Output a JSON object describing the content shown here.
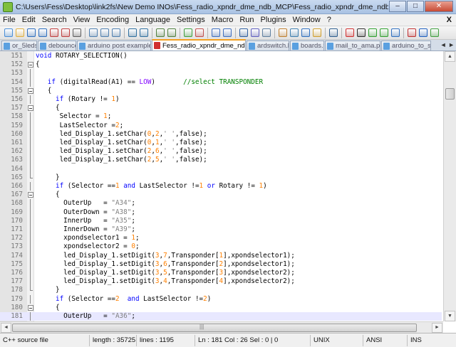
{
  "window": {
    "title": "C:\\Users\\Fess\\Desktop\\link2fs\\New Demo INOs\\Fess_radio_xpndr_dme_ndb_MCP\\Fess_radio_xpndr_dme_ndb_MCP.ino - Notepad++ [Administrator]",
    "minimize": "–",
    "maximize": "□",
    "close": "✕"
  },
  "menu": [
    "File",
    "Edit",
    "Search",
    "View",
    "Encoding",
    "Language",
    "Settings",
    "Macro",
    "Run",
    "Plugins",
    "Window",
    "?"
  ],
  "menu_close": "X",
  "toolbar": [
    "new-file-icon",
    "open-file-icon",
    "save-icon",
    "save-all-icon",
    "close-icon",
    "close-all-icon",
    "print-icon",
    "sep",
    "cut-icon",
    "copy-icon",
    "paste-icon",
    "sep",
    "undo-icon",
    "redo-icon",
    "sep",
    "find-icon",
    "replace-icon",
    "sep",
    "zoom-in-icon",
    "zoom-out-icon",
    "sep",
    "sync-vertical-icon",
    "sync-horizontal-icon",
    "sep",
    "word-wrap-icon",
    "show-all-chars-icon",
    "indent-guide-icon",
    "sep",
    "user-language-icon",
    "doc-map-icon",
    "function-list-icon",
    "folder-workspace-icon",
    "sep",
    "monitoring-icon",
    "sep",
    "record-macro-icon",
    "stop-record-icon",
    "play-macro-icon",
    "play-multiple-icon",
    "save-macro-icon",
    "sep",
    "spell-check-icon",
    "spell-next-icon",
    "spell-settings-icon"
  ],
  "tabs": [
    {
      "label": "or_5leds.ino",
      "active": false
    },
    {
      "label": "debounce.c",
      "active": false
    },
    {
      "label": "arduino post example.txt",
      "active": false
    },
    {
      "label": "Fess_radio_xpndr_dme_ndb_MCP.ino",
      "active": true
    },
    {
      "label": "ardswitch.lua",
      "active": false
    },
    {
      "label": "boards.txt",
      "active": false
    },
    {
      "label": "mail_to_ama.php",
      "active": false
    },
    {
      "label": "arduino_to_s...",
      "active": false
    }
  ],
  "tab_scroll": "◄ ►",
  "code_lines": [
    {
      "n": "151",
      "fold": "",
      "segs": [
        {
          "c": "kw",
          "t": "void"
        },
        {
          "t": " ROTARY_SELECTION()"
        }
      ]
    },
    {
      "n": "152",
      "fold": "box",
      "segs": [
        {
          "t": "{"
        }
      ]
    },
    {
      "n": "153",
      "fold": "bar",
      "segs": []
    },
    {
      "n": "154",
      "fold": "bar",
      "segs": [
        {
          "t": "   "
        },
        {
          "c": "kw",
          "t": "if"
        },
        {
          "t": " (digitalRead(A1) == "
        },
        {
          "c": "typ",
          "t": "LOW"
        },
        {
          "t": ")       "
        },
        {
          "c": "cmt",
          "t": "//select TRANSPONDER"
        }
      ]
    },
    {
      "n": "155",
      "fold": "box",
      "segs": [
        {
          "t": "   {"
        }
      ]
    },
    {
      "n": "156",
      "fold": "bar",
      "segs": [
        {
          "t": "     "
        },
        {
          "c": "kw",
          "t": "if"
        },
        {
          "t": " (Rotary != "
        },
        {
          "c": "num",
          "t": "1"
        },
        {
          "t": ")"
        }
      ]
    },
    {
      "n": "157",
      "fold": "box",
      "segs": [
        {
          "t": "     {"
        }
      ]
    },
    {
      "n": "158",
      "fold": "bar",
      "segs": [
        {
          "t": "      Selector = "
        },
        {
          "c": "num",
          "t": "1"
        },
        {
          "t": ";"
        }
      ]
    },
    {
      "n": "159",
      "fold": "bar",
      "segs": [
        {
          "t": "      LastSelector ="
        },
        {
          "c": "num",
          "t": "2"
        },
        {
          "t": ";"
        }
      ]
    },
    {
      "n": "160",
      "fold": "bar",
      "segs": [
        {
          "t": "      led_Display_1.setChar("
        },
        {
          "c": "num",
          "t": "0"
        },
        {
          "t": ","
        },
        {
          "c": "num",
          "t": "2"
        },
        {
          "t": ","
        },
        {
          "c": "str",
          "t": "' '"
        },
        {
          "t": ",false);"
        }
      ]
    },
    {
      "n": "161",
      "fold": "bar",
      "segs": [
        {
          "t": "      led_Display_1.setChar("
        },
        {
          "c": "num",
          "t": "0"
        },
        {
          "t": ","
        },
        {
          "c": "num",
          "t": "1"
        },
        {
          "t": ","
        },
        {
          "c": "str",
          "t": "' '"
        },
        {
          "t": ",false);"
        }
      ]
    },
    {
      "n": "162",
      "fold": "bar",
      "segs": [
        {
          "t": "      led_Display_1.setChar("
        },
        {
          "c": "num",
          "t": "2"
        },
        {
          "t": ","
        },
        {
          "c": "num",
          "t": "6"
        },
        {
          "t": ","
        },
        {
          "c": "str",
          "t": "' '"
        },
        {
          "t": ",false);"
        }
      ]
    },
    {
      "n": "163",
      "fold": "bar",
      "segs": [
        {
          "t": "      led_Display_1.setChar("
        },
        {
          "c": "num",
          "t": "2"
        },
        {
          "t": ","
        },
        {
          "c": "num",
          "t": "5"
        },
        {
          "t": ","
        },
        {
          "c": "str",
          "t": "' '"
        },
        {
          "t": ",false);"
        }
      ]
    },
    {
      "n": "164",
      "fold": "bar",
      "segs": []
    },
    {
      "n": "165",
      "fold": "end",
      "segs": [
        {
          "t": "     }"
        }
      ]
    },
    {
      "n": "166",
      "fold": "bar",
      "segs": [
        {
          "t": "     "
        },
        {
          "c": "kw",
          "t": "if"
        },
        {
          "t": " (Selector =="
        },
        {
          "c": "num",
          "t": "1"
        },
        {
          "t": " "
        },
        {
          "c": "kw",
          "t": "and"
        },
        {
          "t": " LastSelector !="
        },
        {
          "c": "num",
          "t": "1"
        },
        {
          "t": " "
        },
        {
          "c": "kw",
          "t": "or"
        },
        {
          "t": " Rotary != "
        },
        {
          "c": "num",
          "t": "1"
        },
        {
          "t": ")"
        }
      ]
    },
    {
      "n": "167",
      "fold": "box",
      "segs": [
        {
          "t": "     {"
        }
      ]
    },
    {
      "n": "168",
      "fold": "bar",
      "segs": [
        {
          "t": "       OuterUp   = "
        },
        {
          "c": "str",
          "t": "\"A34\""
        },
        {
          "t": ";"
        }
      ]
    },
    {
      "n": "169",
      "fold": "bar",
      "segs": [
        {
          "t": "       OuterDown = "
        },
        {
          "c": "str",
          "t": "\"A38\""
        },
        {
          "t": ";"
        }
      ]
    },
    {
      "n": "170",
      "fold": "bar",
      "segs": [
        {
          "t": "       InnerUp   = "
        },
        {
          "c": "str",
          "t": "\"A35\""
        },
        {
          "t": ";"
        }
      ]
    },
    {
      "n": "171",
      "fold": "bar",
      "segs": [
        {
          "t": "       InnerDown = "
        },
        {
          "c": "str",
          "t": "\"A39\""
        },
        {
          "t": ";"
        }
      ]
    },
    {
      "n": "172",
      "fold": "bar",
      "segs": [
        {
          "t": "       xpondselector1 = "
        },
        {
          "c": "num",
          "t": "1"
        },
        {
          "t": ";"
        }
      ]
    },
    {
      "n": "173",
      "fold": "bar",
      "segs": [
        {
          "t": "       xpondselector2 = "
        },
        {
          "c": "num",
          "t": "0"
        },
        {
          "t": ";"
        }
      ]
    },
    {
      "n": "174",
      "fold": "bar",
      "segs": [
        {
          "t": "       led_Display_1.setDigit("
        },
        {
          "c": "num",
          "t": "3"
        },
        {
          "t": ","
        },
        {
          "c": "num",
          "t": "7"
        },
        {
          "t": ",Transponder["
        },
        {
          "c": "num",
          "t": "1"
        },
        {
          "t": "],xpondselector1);"
        }
      ]
    },
    {
      "n": "175",
      "fold": "bar",
      "segs": [
        {
          "t": "       led_Display_1.setDigit("
        },
        {
          "c": "num",
          "t": "3"
        },
        {
          "t": ","
        },
        {
          "c": "num",
          "t": "6"
        },
        {
          "t": ",Transponder["
        },
        {
          "c": "num",
          "t": "2"
        },
        {
          "t": "],xpondselector1);"
        }
      ]
    },
    {
      "n": "176",
      "fold": "bar",
      "segs": [
        {
          "t": "       led_Display_1.setDigit("
        },
        {
          "c": "num",
          "t": "3"
        },
        {
          "t": ","
        },
        {
          "c": "num",
          "t": "5"
        },
        {
          "t": ",Transponder["
        },
        {
          "c": "num",
          "t": "3"
        },
        {
          "t": "],xpondselector2);"
        }
      ]
    },
    {
      "n": "177",
      "fold": "bar",
      "segs": [
        {
          "t": "       led_Display_1.setDigit("
        },
        {
          "c": "num",
          "t": "3"
        },
        {
          "t": ","
        },
        {
          "c": "num",
          "t": "4"
        },
        {
          "t": ",Transponder["
        },
        {
          "c": "num",
          "t": "4"
        },
        {
          "t": "],xpondselector2);"
        }
      ]
    },
    {
      "n": "178",
      "fold": "end",
      "segs": [
        {
          "t": "     }"
        }
      ]
    },
    {
      "n": "179",
      "fold": "bar",
      "segs": [
        {
          "t": "     "
        },
        {
          "c": "kw",
          "t": "if"
        },
        {
          "t": " (Selector =="
        },
        {
          "c": "num",
          "t": "2"
        },
        {
          "t": "  "
        },
        {
          "c": "kw",
          "t": "and"
        },
        {
          "t": " LastSelector !="
        },
        {
          "c": "num",
          "t": "2"
        },
        {
          "t": ")"
        }
      ]
    },
    {
      "n": "180",
      "fold": "box",
      "segs": [
        {
          "t": "     {"
        }
      ]
    },
    {
      "n": "181",
      "fold": "bar",
      "current": true,
      "segs": [
        {
          "t": "       OuterUp   = "
        },
        {
          "c": "str",
          "t": "\"A36\""
        },
        {
          "t": ";"
        }
      ]
    }
  ],
  "status": {
    "lang": "C++ source file",
    "length": "length : 35725",
    "lines": "lines : 1195",
    "pos": "Ln : 181   Col : 26   Sel : 0 | 0",
    "eol": "UNIX",
    "enc": "ANSI",
    "mode": "INS"
  }
}
